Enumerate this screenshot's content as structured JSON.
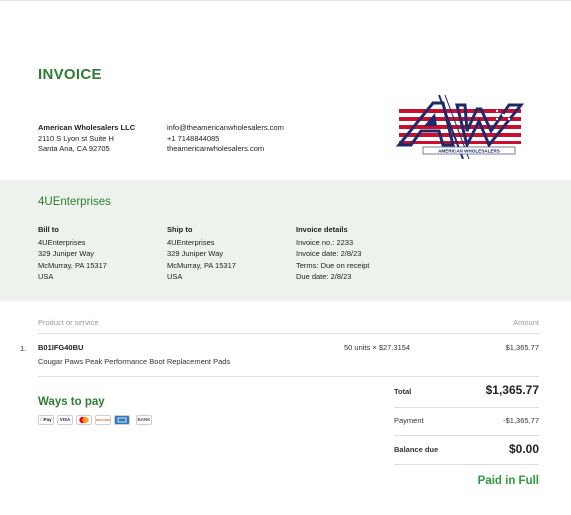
{
  "invoice": {
    "title": "INVOICE",
    "seller": {
      "name": "American Wholesalers LLC",
      "address_line1": "2110 S Lyon st Suite H",
      "address_line2": "Santa Ana, CA 92705",
      "email": "info@theamericanwholesalers.com",
      "phone": "+1 7148844085",
      "website": "theamericanwholesalers.com",
      "logo_text": "AW",
      "logo_subtext": "AMERICAN WHOLESALERS"
    },
    "client_name": "4UEnterprises",
    "bill_to": {
      "heading": "Bill to",
      "name": "4UEnterprises",
      "street": "329 Juniper Way",
      "city": "McMurray, PA 15317",
      "country": "USA"
    },
    "ship_to": {
      "heading": "Ship to",
      "name": "4UEnterprises",
      "street": "329 Juniper Way",
      "city": "McMurray, PA 15317",
      "country": "USA"
    },
    "details": {
      "heading": "Invoice details",
      "invoice_no": "Invoice no.: 2233",
      "invoice_date": "Invoice date: 2/8/23",
      "terms": "Terms: Due on receipt",
      "due_date": "Due date: 2/8/23"
    },
    "table": {
      "col_product": "Product or service",
      "col_amount": "Amount",
      "items": [
        {
          "number": "1.",
          "sku": "B01IFG40BU",
          "description": "Cougar Paws Peak Performance Boot Replacement Pads",
          "qty_rate": "50 units × $27.3154",
          "amount": "$1,365.77"
        }
      ]
    },
    "ways_to_pay": {
      "heading": "Ways to pay",
      "methods": [
        "Pay",
        "VISA",
        "",
        "DISCOVER",
        "",
        "BANK"
      ]
    },
    "summary": {
      "total_label": "Total",
      "total_value": "$1,365.77",
      "payment_label": "Payment",
      "payment_value": "-$1,365.77",
      "balance_label": "Balance due",
      "balance_value": "$0.00"
    },
    "status": "Paid in Full",
    "colors": {
      "accent": "#2e7d32",
      "band": "#eef2ec",
      "paid": "#2e9a3c"
    }
  }
}
